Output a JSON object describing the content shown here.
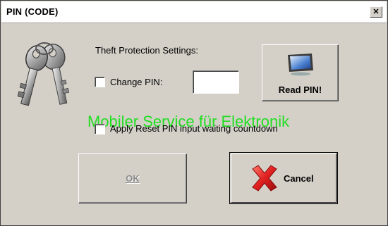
{
  "window": {
    "title": "PIN (CODE)",
    "close_glyph": "✕"
  },
  "content": {
    "section_label": "Theft Protection Settings:",
    "change_pin": {
      "label": "Change PIN:",
      "checked": false,
      "value": ""
    },
    "reset_pin": {
      "label": "Apply Reset PIN input waiting countdown",
      "checked": false
    },
    "watermark": "Mobiler Service für Elektronik"
  },
  "buttons": {
    "read_pin": {
      "label": "Read PIN!",
      "icon": "monitor-icon"
    },
    "ok": {
      "label": "OK",
      "enabled": false
    },
    "cancel": {
      "label": "Cancel",
      "icon": "red-x-icon"
    }
  },
  "icons": {
    "keys": "keys-icon"
  },
  "colors": {
    "window_bg": "#d4d0c8",
    "watermark": "#22dd22",
    "cancel_x": "#e02020"
  }
}
